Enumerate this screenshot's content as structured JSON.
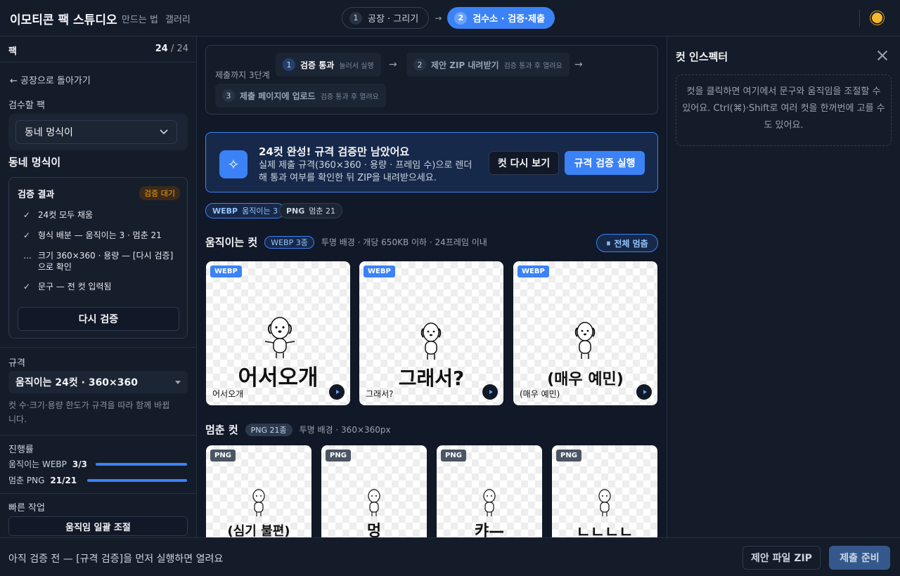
{
  "app": {
    "title": "이모티콘 팩 스튜디오",
    "nav": [
      "만드는 법",
      "갤러리"
    ]
  },
  "steps": [
    {
      "num": "1",
      "label": "공장 · 그리기",
      "active": false
    },
    {
      "num": "2",
      "label": "검수소 · 검증·제출",
      "active": true
    }
  ],
  "sidebar": {
    "pack_label": "팩",
    "count_current": "24",
    "count_total": "/ 24",
    "back_label": "← 공장으로 돌아가기",
    "select_label": "검수할 팩",
    "selected_pack": "동네 멍식이",
    "pack_title": "동네 멍식이",
    "result": {
      "title": "검증 결과",
      "badge": "검증 대기",
      "items": [
        {
          "mark": "✓",
          "text": "24컷 모두 채움"
        },
        {
          "mark": "✓",
          "text": "형식 배분 — 움직이는 3 · 멈춘 21"
        },
        {
          "mark": "…",
          "text": "크기 360×360 · 용량 — [다시 검증] 으로 확인"
        },
        {
          "mark": "✓",
          "text": "문구 — 전 컷 입력됨"
        }
      ],
      "recheck_label": "다시 검증"
    },
    "spec_label": "규격",
    "spec_value": "움직이는 24컷 · 360×360",
    "spec_note": "컷 수·크기·용량 한도가 규격을 따라 함께 바뀝니다.",
    "progress_label": "진행률",
    "progress": [
      {
        "label": "움직이는 WEBP",
        "value": "3/3",
        "fraction": 1.0
      },
      {
        "label": "멈춘 PNG",
        "value": "21/21",
        "fraction": 1.0
      }
    ],
    "quick_label": "빠른 작업",
    "quick_button": "움직임 일괄 조절"
  },
  "main": {
    "steps_card": {
      "label": "제출까지 3단계",
      "steps": [
        {
          "num": "1",
          "title": "검증 통과",
          "sub": "눌러서 실행"
        },
        {
          "num": "2",
          "title": "제안 ZIP 내려받기",
          "sub": "검증 통과 후 열려요"
        },
        {
          "num": "3",
          "title": "제출 페이지에 업로드",
          "sub": "검증 통과 후 열려요"
        }
      ]
    },
    "banner": {
      "icon": "sparkle-icon",
      "title": "24컷 완성! 규격 검증만 남았어요",
      "desc": "실제 제출 규격(360×360 · 용량 · 프레임 수)으로 렌더해 통과 여부를 확인한 뒤 ZIP을 내려받으세요.",
      "review_button": "컷 다시 보기",
      "run_button": "규격 검증 실행"
    },
    "chips": [
      {
        "format": "WEBP",
        "text": "움직이는 3"
      },
      {
        "format": "PNG",
        "text": "멈춘 21"
      }
    ],
    "animated": {
      "title": "움직이는 컷",
      "tag": "WEBP 3종",
      "note": "투명 배경 · 개당 650KB 이하 · 24프레임 이내",
      "pause_button": "전체 멈춤",
      "tiles": [
        {
          "badge": "WEBP",
          "big": "어서오개",
          "caption": "어서오개"
        },
        {
          "badge": "WEBP",
          "big": "그래서?",
          "caption": "그래서?"
        },
        {
          "badge": "WEBP",
          "big": "(매우 예민)",
          "caption": "(매우 예민)"
        }
      ]
    },
    "still": {
      "title": "멈춘 컷",
      "tag": "PNG 21종",
      "note": "투명 배경 · 360×360px",
      "tiles": [
        {
          "badge": "PNG",
          "big": "(심기 불편)"
        },
        {
          "badge": "PNG",
          "big": "멍"
        },
        {
          "badge": "PNG",
          "big": "캬—"
        },
        {
          "badge": "PNG",
          "big": "ㄴㄴㄴㄴ"
        }
      ]
    }
  },
  "inspector": {
    "title": "컷 인스펙터",
    "hint": "컷을 클릭하면 여기에서 문구와 움직임을 조절할 수 있어요. Ctrl(⌘)·Shift로 여러 컷을 한꺼번에 고를 수도 있어요."
  },
  "footer": {
    "status": "아직 검증 전 — [규격 검증]을 먼저 실행하면 열려요",
    "zip_button": "제안 파일 ZIP",
    "submit_button": "제출 준비"
  },
  "colors": {
    "accent": "#3b82f6",
    "background": "#111827",
    "panel": "#141b29",
    "warning": "#f59e0b"
  }
}
